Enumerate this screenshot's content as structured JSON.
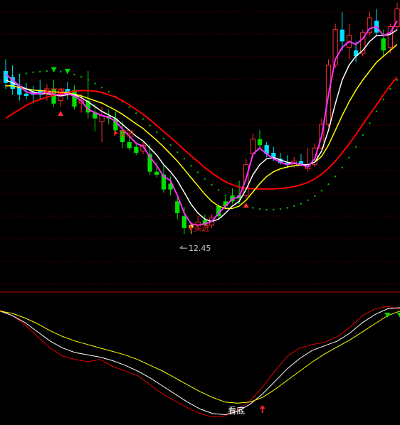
{
  "chart_data": [
    {
      "type": "candlestick",
      "panel": "main",
      "price_range": [
        11.6,
        16.4
      ],
      "grid": true,
      "colors": {
        "up": "#ff3030",
        "down_bar": "#00e000",
        "down_cyan": "#00e0ff",
        "ma_white": "#ffffff",
        "ma_yellow": "#ffff00",
        "ma_magenta": "#ff30ff",
        "ma_red": "#ff0000",
        "dots": "#00c000",
        "grid": "#7a0000",
        "separator": "#c00000",
        "buy_label": "#ff2020",
        "low_label": "#c8c8c8"
      },
      "candles": [
        {
          "o": 15.2,
          "h": 15.4,
          "l": 14.9,
          "c": 15.0,
          "col": "cyan"
        },
        {
          "o": 15.1,
          "h": 15.3,
          "l": 14.8,
          "c": 14.9,
          "col": "cyan"
        },
        {
          "o": 14.95,
          "h": 15.15,
          "l": 14.7,
          "c": 14.8,
          "col": "cyan"
        },
        {
          "o": 14.82,
          "h": 15.0,
          "l": 14.72,
          "c": 14.78,
          "col": "cyan"
        },
        {
          "o": 14.8,
          "h": 14.95,
          "l": 14.65,
          "c": 14.85,
          "col": "cyan"
        },
        {
          "o": 14.88,
          "h": 15.05,
          "l": 14.72,
          "c": 14.8,
          "col": "cyan"
        },
        {
          "o": 14.82,
          "h": 14.98,
          "l": 14.7,
          "c": 14.9,
          "col": "up"
        },
        {
          "o": 14.9,
          "h": 15.05,
          "l": 14.6,
          "c": 14.65,
          "col": "down"
        },
        {
          "o": 14.7,
          "h": 14.92,
          "l": 14.6,
          "c": 14.88,
          "col": "up"
        },
        {
          "o": 14.9,
          "h": 15.02,
          "l": 14.72,
          "c": 14.82,
          "col": "cyan"
        },
        {
          "o": 14.88,
          "h": 14.96,
          "l": 14.55,
          "c": 14.6,
          "col": "down"
        },
        {
          "o": 14.66,
          "h": 14.82,
          "l": 14.5,
          "c": 14.7,
          "col": "up"
        },
        {
          "o": 14.7,
          "h": 15.2,
          "l": 14.4,
          "c": 14.5,
          "col": "down"
        },
        {
          "o": 14.5,
          "h": 14.65,
          "l": 14.18,
          "c": 14.4,
          "col": "down"
        },
        {
          "o": 14.35,
          "h": 14.6,
          "l": 14.0,
          "c": 14.45,
          "col": "up"
        },
        {
          "o": 14.44,
          "h": 14.55,
          "l": 14.3,
          "c": 14.4,
          "col": "down"
        },
        {
          "o": 14.4,
          "h": 14.52,
          "l": 14.15,
          "c": 14.2,
          "col": "down"
        },
        {
          "o": 14.2,
          "h": 14.35,
          "l": 13.9,
          "c": 14.0,
          "col": "down"
        },
        {
          "o": 14.0,
          "h": 14.12,
          "l": 13.86,
          "c": 13.9,
          "col": "down"
        },
        {
          "o": 13.92,
          "h": 13.98,
          "l": 13.78,
          "c": 13.82,
          "col": "down"
        },
        {
          "o": 13.85,
          "h": 14.0,
          "l": 13.8,
          "c": 13.95,
          "col": "up"
        },
        {
          "o": 13.8,
          "h": 13.96,
          "l": 13.45,
          "c": 13.5,
          "col": "down"
        },
        {
          "o": 13.5,
          "h": 13.66,
          "l": 13.4,
          "c": 13.45,
          "col": "down"
        },
        {
          "o": 13.45,
          "h": 13.6,
          "l": 13.15,
          "c": 13.2,
          "col": "down"
        },
        {
          "o": 13.2,
          "h": 13.42,
          "l": 13.1,
          "c": 13.3,
          "col": "down"
        },
        {
          "o": 13.0,
          "h": 13.1,
          "l": 12.7,
          "c": 12.8,
          "col": "down"
        },
        {
          "o": 12.75,
          "h": 12.9,
          "l": 12.45,
          "c": 12.55,
          "col": "down"
        },
        {
          "o": 12.55,
          "h": 12.65,
          "l": 12.45,
          "c": 12.6,
          "col": "yellow"
        },
        {
          "o": 12.6,
          "h": 12.75,
          "l": 12.55,
          "c": 12.65,
          "col": "up"
        },
        {
          "o": 12.68,
          "h": 12.78,
          "l": 12.58,
          "c": 12.6,
          "col": "down"
        },
        {
          "o": 12.6,
          "h": 12.78,
          "l": 12.55,
          "c": 12.72,
          "col": "up"
        },
        {
          "o": 12.75,
          "h": 12.95,
          "l": 12.7,
          "c": 12.92,
          "col": "down"
        },
        {
          "o": 12.92,
          "h": 13.08,
          "l": 12.88,
          "c": 13.0,
          "col": "down"
        },
        {
          "o": 13.0,
          "h": 13.22,
          "l": 12.96,
          "c": 13.1,
          "col": "down"
        },
        {
          "o": 13.05,
          "h": 13.35,
          "l": 13.0,
          "c": 13.1,
          "col": "down"
        },
        {
          "o": 13.1,
          "h": 13.72,
          "l": 13.05,
          "c": 13.62,
          "col": "up"
        },
        {
          "o": 13.8,
          "h": 14.15,
          "l": 13.75,
          "c": 14.05,
          "col": "up"
        },
        {
          "o": 14.05,
          "h": 14.2,
          "l": 13.88,
          "c": 13.95,
          "col": "down"
        },
        {
          "o": 13.95,
          "h": 14.0,
          "l": 13.75,
          "c": 13.8,
          "col": "cyan"
        },
        {
          "o": 13.82,
          "h": 13.92,
          "l": 13.68,
          "c": 13.72,
          "col": "cyan"
        },
        {
          "o": 13.72,
          "h": 13.82,
          "l": 13.62,
          "c": 13.65,
          "col": "cyan"
        },
        {
          "o": 13.65,
          "h": 13.78,
          "l": 13.56,
          "c": 13.62,
          "col": "cyan"
        },
        {
          "o": 13.6,
          "h": 13.75,
          "l": 13.56,
          "c": 13.68,
          "col": "up"
        },
        {
          "o": 13.68,
          "h": 13.8,
          "l": 13.6,
          "c": 13.62,
          "col": "cyan"
        },
        {
          "o": 13.62,
          "h": 13.9,
          "l": 13.5,
          "c": 13.55,
          "col": "up"
        },
        {
          "o": 13.62,
          "h": 13.98,
          "l": 13.58,
          "c": 13.9,
          "col": "up"
        },
        {
          "o": 13.9,
          "h": 14.4,
          "l": 13.88,
          "c": 14.3,
          "col": "up"
        },
        {
          "o": 14.3,
          "h": 15.4,
          "l": 14.25,
          "c": 15.3,
          "col": "up"
        },
        {
          "o": 15.3,
          "h": 16.0,
          "l": 15.25,
          "c": 15.9,
          "col": "up"
        },
        {
          "o": 15.9,
          "h": 16.2,
          "l": 15.55,
          "c": 15.7,
          "col": "cyan"
        },
        {
          "o": 15.6,
          "h": 16.0,
          "l": 15.4,
          "c": 15.8,
          "col": "up"
        },
        {
          "o": 15.55,
          "h": 15.7,
          "l": 15.35,
          "c": 15.45,
          "col": "cyan"
        },
        {
          "o": 15.5,
          "h": 15.9,
          "l": 15.45,
          "c": 15.85,
          "col": "up"
        },
        {
          "o": 15.85,
          "h": 16.2,
          "l": 15.8,
          "c": 16.1,
          "col": "up"
        },
        {
          "o": 16.05,
          "h": 16.25,
          "l": 15.8,
          "c": 15.85,
          "col": "cyan"
        },
        {
          "o": 15.75,
          "h": 15.9,
          "l": 15.45,
          "c": 15.55,
          "col": "down"
        },
        {
          "o": 15.6,
          "h": 16.0,
          "l": 15.5,
          "c": 15.95,
          "col": "up"
        },
        {
          "o": 15.95,
          "h": 16.35,
          "l": 15.9,
          "c": 16.25,
          "col": "up"
        }
      ],
      "series": [
        {
          "color": "magenta",
          "values": [
            15.15,
            15.05,
            14.95,
            14.85,
            14.82,
            14.82,
            14.85,
            14.8,
            14.8,
            14.82,
            14.78,
            14.7,
            14.55,
            14.5,
            14.45,
            14.42,
            14.35,
            14.22,
            14.1,
            13.98,
            13.93,
            13.75,
            13.6,
            13.42,
            13.35,
            13.1,
            12.8,
            12.62,
            12.6,
            12.62,
            12.66,
            12.8,
            12.92,
            13.04,
            13.08,
            13.38,
            13.8,
            13.9,
            13.8,
            13.72,
            13.66,
            13.62,
            13.65,
            13.62,
            13.58,
            13.72,
            14.1,
            14.8,
            15.4,
            15.6,
            15.7,
            15.65,
            15.75,
            15.92,
            15.95,
            15.8,
            15.85,
            16.05
          ]
        },
        {
          "color": "white",
          "values": [
            15.05,
            15.0,
            14.95,
            14.9,
            14.85,
            14.82,
            14.82,
            14.8,
            14.78,
            14.8,
            14.8,
            14.75,
            14.68,
            14.6,
            14.52,
            14.46,
            14.4,
            14.3,
            14.2,
            14.1,
            14.02,
            13.9,
            13.78,
            13.62,
            13.5,
            13.35,
            13.15,
            12.95,
            12.8,
            12.7,
            12.66,
            12.7,
            12.8,
            12.92,
            13.0,
            13.2,
            13.45,
            13.62,
            13.72,
            13.74,
            13.7,
            13.66,
            13.64,
            13.62,
            13.62,
            13.66,
            13.85,
            14.2,
            14.65,
            15.05,
            15.3,
            15.45,
            15.55,
            15.7,
            15.8,
            15.8,
            15.82,
            15.9
          ]
        },
        {
          "color": "yellow",
          "values": [
            14.95,
            14.95,
            14.92,
            14.9,
            14.88,
            14.87,
            14.86,
            14.85,
            14.84,
            14.83,
            14.81,
            14.78,
            14.74,
            14.7,
            14.66,
            14.6,
            14.54,
            14.47,
            14.39,
            14.31,
            14.23,
            14.13,
            14.03,
            13.92,
            13.8,
            13.68,
            13.54,
            13.4,
            13.26,
            13.12,
            13.0,
            12.92,
            12.88,
            12.88,
            12.92,
            13.02,
            13.16,
            13.3,
            13.42,
            13.5,
            13.55,
            13.58,
            13.6,
            13.61,
            13.62,
            13.66,
            13.76,
            13.95,
            14.2,
            14.45,
            14.68,
            14.88,
            15.05,
            15.2,
            15.35,
            15.45,
            15.55,
            15.65
          ]
        },
        {
          "color": "red",
          "values": [
            14.4,
            14.48,
            14.55,
            14.62,
            14.68,
            14.72,
            14.76,
            14.79,
            14.82,
            14.84,
            14.86,
            14.87,
            14.87,
            14.86,
            14.84,
            14.8,
            14.76,
            14.7,
            14.63,
            14.55,
            14.47,
            14.38,
            14.28,
            14.18,
            14.08,
            13.98,
            13.87,
            13.77,
            13.67,
            13.57,
            13.48,
            13.4,
            13.33,
            13.28,
            13.24,
            13.22,
            13.21,
            13.21,
            13.21,
            13.21,
            13.22,
            13.23,
            13.25,
            13.28,
            13.32,
            13.38,
            13.46,
            13.56,
            13.68,
            13.82,
            13.97,
            14.13,
            14.3,
            14.47,
            14.63,
            14.8,
            14.96,
            15.1
          ]
        },
        {
          "color": "dots",
          "values": [
            15.1,
            15.12,
            15.14,
            15.16,
            15.18,
            15.19,
            15.2,
            15.2,
            15.19,
            15.17,
            15.14,
            15.1,
            15.05,
            14.99,
            14.92,
            14.85,
            14.77,
            14.68,
            14.59,
            14.49,
            14.39,
            14.28,
            14.17,
            14.06,
            13.95,
            13.83,
            13.72,
            13.6,
            13.49,
            13.38,
            13.28,
            13.19,
            13.1,
            13.03,
            12.97,
            12.92,
            12.89,
            12.87,
            12.86,
            12.86,
            12.87,
            12.89,
            12.92,
            12.96,
            13.02,
            13.09,
            13.18,
            13.29,
            13.42,
            13.57,
            13.74,
            13.92,
            14.12,
            14.32,
            14.52,
            14.72,
            14.9,
            15.05
          ]
        }
      ],
      "markers": [
        {
          "type": "arrow-up",
          "candle": 35,
          "color": "red"
        },
        {
          "type": "arrow-up",
          "candle": 8,
          "color": "red"
        },
        {
          "type": "triangle-down",
          "candle": 7,
          "color": "green"
        },
        {
          "type": "triangle-down",
          "candle": 9,
          "color": "green"
        }
      ],
      "annotations": [
        {
          "label": "买进",
          "candle": 6
        },
        {
          "label": "买进",
          "candle": 16
        },
        {
          "label": "买进",
          "candle": 27
        }
      ],
      "low_label": {
        "text": "12.45",
        "price": 12.45,
        "candle": 26
      }
    },
    {
      "type": "line",
      "panel": "indicator",
      "y_range": [
        0,
        100
      ],
      "series": [
        {
          "color": "red",
          "values": [
            95,
            90,
            82,
            72,
            62,
            55,
            52,
            50,
            52,
            46,
            42,
            38,
            30,
            22,
            16,
            10,
            5,
            2,
            3,
            8,
            16,
            28,
            42,
            55,
            62,
            65,
            67,
            72,
            80,
            90,
            96,
            98,
            96
          ]
        },
        {
          "color": "white",
          "values": [
            94,
            90,
            84,
            76,
            68,
            62,
            58,
            56,
            54,
            51,
            47,
            42,
            36,
            29,
            22,
            15,
            9,
            5,
            4,
            7,
            13,
            22,
            33,
            44,
            53,
            60,
            64,
            68,
            75,
            84,
            91,
            96,
            97
          ]
        },
        {
          "color": "yellow",
          "values": [
            94,
            92,
            88,
            83,
            77,
            72,
            68,
            65,
            62,
            59,
            56,
            52,
            47,
            42,
            36,
            30,
            24,
            19,
            15,
            14,
            15,
            19,
            26,
            34,
            42,
            50,
            57,
            63,
            69,
            76,
            83,
            90,
            94
          ]
        }
      ],
      "annotation": {
        "label": "看底",
        "x_index": 18
      },
      "markers": [
        {
          "type": "arrow-up",
          "x_index": 21,
          "color": "red"
        },
        {
          "type": "triangle-down",
          "x_index": 31,
          "color": "green"
        },
        {
          "type": "triangle-down",
          "x_index": 32,
          "color": "green"
        }
      ]
    }
  ]
}
